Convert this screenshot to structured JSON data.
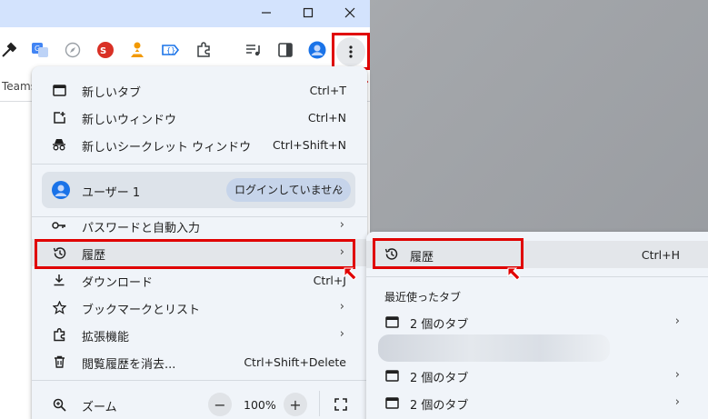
{
  "window": {
    "bookmark_text": "Teams"
  },
  "menu": {
    "items_top": [
      {
        "label": "新しいタブ",
        "shortcut": "Ctrl+T"
      },
      {
        "label": "新しいウィンドウ",
        "shortcut": "Ctrl+N"
      },
      {
        "label": "新しいシークレット ウィンドウ",
        "shortcut": "Ctrl+Shift+N"
      }
    ],
    "profile": {
      "name": "ユーザー 1",
      "status": "ログインしていません"
    },
    "items_mid": [
      {
        "label": "パスワードと自動入力"
      },
      {
        "label": "履歴"
      },
      {
        "label": "ダウンロード",
        "shortcut": "Ctrl+J"
      },
      {
        "label": "ブックマークとリスト"
      },
      {
        "label": "拡張機能"
      },
      {
        "label": "閲覧履歴を消去...",
        "shortcut": "Ctrl+Shift+Delete"
      }
    ],
    "zoom": {
      "label": "ズーム",
      "minus": "−",
      "value": "100%",
      "plus": "+"
    }
  },
  "submenu": {
    "history": {
      "label": "履歴",
      "shortcut": "Ctrl+H"
    },
    "recent_header": "最近使ったタブ",
    "rows": [
      {
        "label": "2 個のタブ"
      },
      {
        "label": "2 個のタブ"
      },
      {
        "label": "2 個のタブ"
      }
    ]
  },
  "colors": {
    "highlight": "#e00000",
    "accent": "#1a73e8",
    "menu_bg": "#f0f4f9"
  }
}
